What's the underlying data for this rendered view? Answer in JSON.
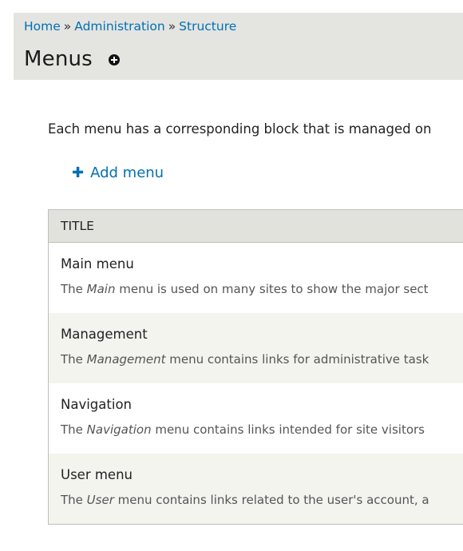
{
  "breadcrumb": {
    "items": [
      "Home",
      "Administration",
      "Structure"
    ],
    "separator": "»"
  },
  "page": {
    "title": "Menus"
  },
  "help_text": "Each menu has a corresponding block that is managed on",
  "actions": {
    "add_menu_label": "Add menu"
  },
  "table": {
    "header": "TITLE",
    "rows": [
      {
        "title": "Main menu",
        "desc_prefix": "The ",
        "desc_name": "Main",
        "desc_suffix": " menu is used on many sites to show the major sect"
      },
      {
        "title": "Management",
        "desc_prefix": "The ",
        "desc_name": "Management",
        "desc_suffix": " menu contains links for administrative task"
      },
      {
        "title": "Navigation",
        "desc_prefix": "The ",
        "desc_name": "Navigation",
        "desc_suffix": " menu contains links intended for site visitors"
      },
      {
        "title": "User menu",
        "desc_prefix": "The ",
        "desc_name": "User",
        "desc_suffix": " menu contains links related to the user's account, a"
      }
    ]
  },
  "colors": {
    "link": "#0071b3",
    "header_bg": "#e4e4e1",
    "table_header_bg": "#e1e2dc",
    "row_alt_bg": "#f3f4ee"
  },
  "icons": {
    "shortcut": "add-shortcut-icon",
    "add": "plus-icon"
  }
}
